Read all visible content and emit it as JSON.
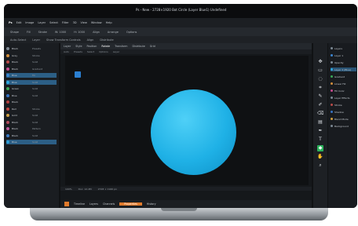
{
  "window": {
    "title": "Ps - New - 2728×1920 Bot Circle (Layer Blue1) Undefined"
  },
  "menubar": {
    "items": [
      "Ps",
      "Edit",
      "Image",
      "Layer",
      "Select",
      "Filter",
      "3D",
      "View",
      "Window",
      "Help"
    ]
  },
  "options_bar": {
    "items": [
      "Shape",
      "Fill",
      "Stroke",
      "W: 1000",
      "H: 1000",
      "Align",
      "Arrange",
      "Options"
    ]
  },
  "toolbar2": {
    "items": [
      "Auto-Select",
      "Layer",
      "Show Transform Controls",
      "Align",
      "Distribute"
    ]
  },
  "left_panel": {
    "rows": [
      {
        "label": "Black",
        "value": "Presets",
        "color": "#7e8893"
      },
      {
        "label": "Gray",
        "value": "Stroke",
        "color": "#d28e3b"
      },
      {
        "label": "Black",
        "value": "Solid",
        "color": "#b94a48"
      },
      {
        "label": "Black",
        "value": "Gradient",
        "color": "#c84b8f"
      },
      {
        "label": "Blue",
        "value": "Fill",
        "color": "#3b86d1",
        "active": true
      },
      {
        "label": "Blue",
        "value": "Solid",
        "color": "#2ea9e0",
        "active": true
      },
      {
        "label": "Green",
        "value": "Solid",
        "color": "#3aa857"
      },
      {
        "label": "Blue",
        "value": "Solid",
        "color": "#3773c4"
      },
      {
        "label": "Black",
        "value": "",
        "color": "#b3403e"
      },
      {
        "label": "Red",
        "value": "Stroke",
        "color": "#c2433f"
      },
      {
        "label": "Gold",
        "value": "Solid",
        "color": "#d1a041"
      },
      {
        "label": "Black",
        "value": "Solid",
        "color": "#b04a5a"
      },
      {
        "label": "Black",
        "value": "Pattern",
        "color": "#c0589a"
      },
      {
        "label": "Black",
        "value": "Solid",
        "color": "#3d7bc4"
      },
      {
        "label": "Blue",
        "value": "Solid",
        "color": "#2e9fd7",
        "active": true
      }
    ]
  },
  "document": {
    "tabs": [
      {
        "label": "Layer",
        "on": false
      },
      {
        "label": "Style",
        "on": false
      },
      {
        "label": "Position",
        "on": false
      },
      {
        "label": "Rotate",
        "on": true
      },
      {
        "label": "Transform",
        "on": false
      },
      {
        "label": "Distribute",
        "on": false
      },
      {
        "label": "Grid",
        "on": false
      }
    ],
    "subbar": [
      "Auto",
      "Presets",
      "Select",
      "Options",
      "Layer"
    ],
    "status": [
      "100%",
      "Doc: 12.4M",
      "2728 × 1920 px"
    ]
  },
  "canvas": {
    "shape": "circle",
    "fill": "#1fb1e6",
    "bg": "#0f1113"
  },
  "bottom_tabs": [
    "Timeline",
    "Layers",
    "Channels",
    "Properties",
    "History"
  ],
  "right_panel": {
    "rows": [
      {
        "label": "Layers",
        "color": "#7a8792"
      },
      {
        "label": "Layer 1",
        "color": "#3b86d1"
      },
      {
        "label": "Opacity",
        "color": "#7a8792"
      },
      {
        "label": "Layer 2 (Blue)",
        "color": "#2ea9e0",
        "active": true
      },
      {
        "label": "Gradient",
        "color": "#3aa857"
      },
      {
        "label": "Linear Fill",
        "color": "#d28e3b"
      },
      {
        "label": "Fill Color",
        "color": "#c84b8f"
      },
      {
        "label": "Layer Effects",
        "color": "#7a8792"
      },
      {
        "label": "Stroke",
        "color": "#b94a48"
      },
      {
        "label": "Shadow",
        "color": "#3773c4"
      },
      {
        "label": "Blend Mode",
        "color": "#d1a041"
      },
      {
        "label": "Background",
        "color": "#7a8792"
      }
    ]
  },
  "tools": [
    "move-icon",
    "marquee-icon",
    "lasso-icon",
    "crop-icon",
    "eyedropper-icon",
    "brush-icon",
    "eraser-icon",
    "gradient-icon",
    "pen-icon",
    "text-icon",
    "shape-icon",
    "hand-icon",
    "zoom-icon"
  ]
}
